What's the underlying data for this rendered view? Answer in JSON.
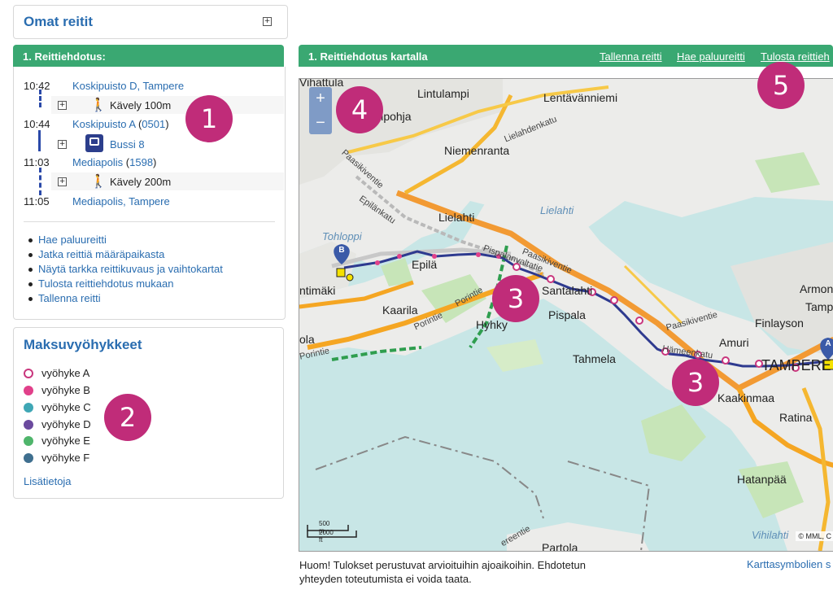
{
  "my_routes": {
    "title": "Omat reitit",
    "expand": "+"
  },
  "route": {
    "header": "1. Reittiehdotus:",
    "steps": [
      {
        "time": "10:42",
        "stop": "Koskipuisto D, Tampere",
        "code": ""
      },
      {
        "time": "10:44",
        "stop": "Koskipuisto A",
        "code": "0501"
      },
      {
        "time": "11:03",
        "stop": "Mediapolis",
        "code": "1598"
      },
      {
        "time": "11:05",
        "stop": "Mediapolis, Tampere",
        "code": ""
      }
    ],
    "legs": [
      {
        "mode": "walk",
        "label": "Kävely 100m"
      },
      {
        "mode": "bus",
        "label": "Bussi 8"
      },
      {
        "mode": "walk",
        "label": "Kävely 200m"
      }
    ],
    "links": [
      "Hae paluureitti",
      "Jatka reittiä määräpaikasta",
      "Näytä tarkka reittikuvaus ja vaihtokartat",
      "Tulosta reittiehdotus mukaan",
      "Tallenna reitti"
    ]
  },
  "zones": {
    "title": "Maksuvyöhykkeet",
    "items": [
      {
        "label": "vyöhyke A",
        "color": "#c9367d",
        "hollow": true
      },
      {
        "label": "vyöhyke B",
        "color": "#e1408a",
        "hollow": false
      },
      {
        "label": "vyöhyke C",
        "color": "#3fa7b5",
        "hollow": false
      },
      {
        "label": "vyöhyke D",
        "color": "#6b4a9e",
        "hollow": false
      },
      {
        "label": "vyöhyke E",
        "color": "#4fb56b",
        "hollow": false
      },
      {
        "label": "vyöhyke F",
        "color": "#3f6f8f",
        "hollow": false
      }
    ],
    "more": "Lisätietoja"
  },
  "map": {
    "header": "1. Reittiehdotus kartalla",
    "actions": [
      "Tallenna reitti",
      "Hae paluureitti",
      "Tulosta reittieh"
    ],
    "zoom_in": "+",
    "zoom_out": "−",
    "marker_a": "A",
    "marker_b": "B",
    "labels": {
      "vihattula": "Vihattula",
      "lintulampi": "Lintulampi",
      "lentavanniemi": "Lentävänniemi",
      "lamminpohja": "mmpohja",
      "lielahdenkatu": "Lielahdenkatu",
      "niemenranta": "Niemenranta",
      "paasikiventie": "Paasikiventie",
      "epilankatu": "Epilänkatu",
      "lielahti": "Lielahti",
      "lielahti_water": "Lielahti",
      "tohloppi": "Tohloppi",
      "epila": "Epilä",
      "paasikiventie2": "Paasikiventie",
      "armon": "Armon",
      "tamp": "Tamp",
      "ntimaki": "ntimäki",
      "santalahti": "Santalahti",
      "pispala": "Pispala",
      "kaarila": "Kaarila",
      "hyhky": "Hyhky",
      "porintie": "Porintie",
      "porintie2": "Porintie",
      "finlayson": "Finlayson",
      "amuri": "Amuri",
      "tampere": "TAMPERE",
      "paasikiventie3": "Paasikiventie",
      "ola": "ola",
      "porintie3": "Porintie",
      "tahmela": "Tahmela",
      "kaakinmaa": "Kaakinmaa",
      "ratina": "Ratina",
      "hatanpaa": "Hatanpää",
      "vihilahti": "Vihilahti",
      "partola": "Partola",
      "ereentie": "ereentie",
      "hameenkatu": "Hämeenkatu",
      "pispalanvaltatie": "Pispalanvaltatie"
    },
    "scale_m": "500 m",
    "scale_ft": "2000 ft",
    "copyright": "© MML, C"
  },
  "footer": {
    "note": "Huom! Tulokset perustuvat arvioituihin ajoaikoihin. Ehdotetun yhteyden toteutumista ei voida taata.",
    "legend_link": "Karttasymbolien s"
  },
  "badges": [
    "1",
    "2",
    "3",
    "4",
    "5"
  ]
}
